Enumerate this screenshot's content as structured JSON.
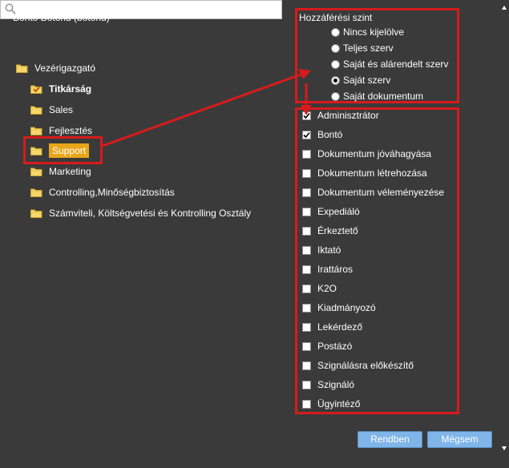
{
  "dialog": {
    "user_title": "Bontó Botond (botond)",
    "search": {
      "value": "",
      "placeholder": ""
    }
  },
  "tree": {
    "items": [
      {
        "label": "Vezérigazgató",
        "bold": false
      },
      {
        "label": "Titkárság",
        "bold": true,
        "checked_folder": true
      },
      {
        "label": "Sales"
      },
      {
        "label": "Fejlesztés"
      },
      {
        "label": "Support",
        "selected": true
      },
      {
        "label": "Marketing"
      },
      {
        "label": "Controlling,Minőségbiztosítás"
      },
      {
        "label": "Számviteli, Költségvetési és Kontrolling Osztály"
      }
    ]
  },
  "access_level": {
    "title": "Hozzáférési szint",
    "options": [
      {
        "label": "Nincs kijelölve",
        "checked": false
      },
      {
        "label": "Teljes szerv",
        "checked": false
      },
      {
        "label": "Saját és alárendelt szerv",
        "checked": false
      },
      {
        "label": "Saját szerv",
        "checked": true
      },
      {
        "label": "Saját dokumentum",
        "checked": false
      }
    ]
  },
  "roles": [
    {
      "label": "Adminisztrátor",
      "checked": true
    },
    {
      "label": "Bontó",
      "checked": true
    },
    {
      "label": "Dokumentum jóváhagyása",
      "checked": false
    },
    {
      "label": "Dokumentum létrehozása",
      "checked": false
    },
    {
      "label": "Dokumentum véleményezése",
      "checked": false
    },
    {
      "label": "Expediáló",
      "checked": false
    },
    {
      "label": "Érkeztető",
      "checked": false
    },
    {
      "label": "Iktató",
      "checked": false
    },
    {
      "label": "Irattáros",
      "checked": false
    },
    {
      "label": "K2O",
      "checked": false
    },
    {
      "label": "Kiadmányozó",
      "checked": false
    },
    {
      "label": "Lekérdező",
      "checked": false
    },
    {
      "label": "Postázó",
      "checked": false
    },
    {
      "label": "Szignálásra előkészítő",
      "checked": false
    },
    {
      "label": "Szignáló",
      "checked": false
    },
    {
      "label": "Ügyintéző",
      "checked": false
    }
  ],
  "buttons": {
    "ok_label": "Rendben",
    "cancel_label": "Mégsem"
  },
  "colors": {
    "background": "#3a3a3a",
    "annotation_red": "#d71b1b",
    "selection": "#e7a619",
    "button": "#7fb5e8",
    "folder": "#f5d76e"
  },
  "icons": {
    "search": "search-icon",
    "folder": "folder-icon",
    "scroll_up": "arrow-up-icon",
    "scroll_down": "arrow-down-icon"
  }
}
